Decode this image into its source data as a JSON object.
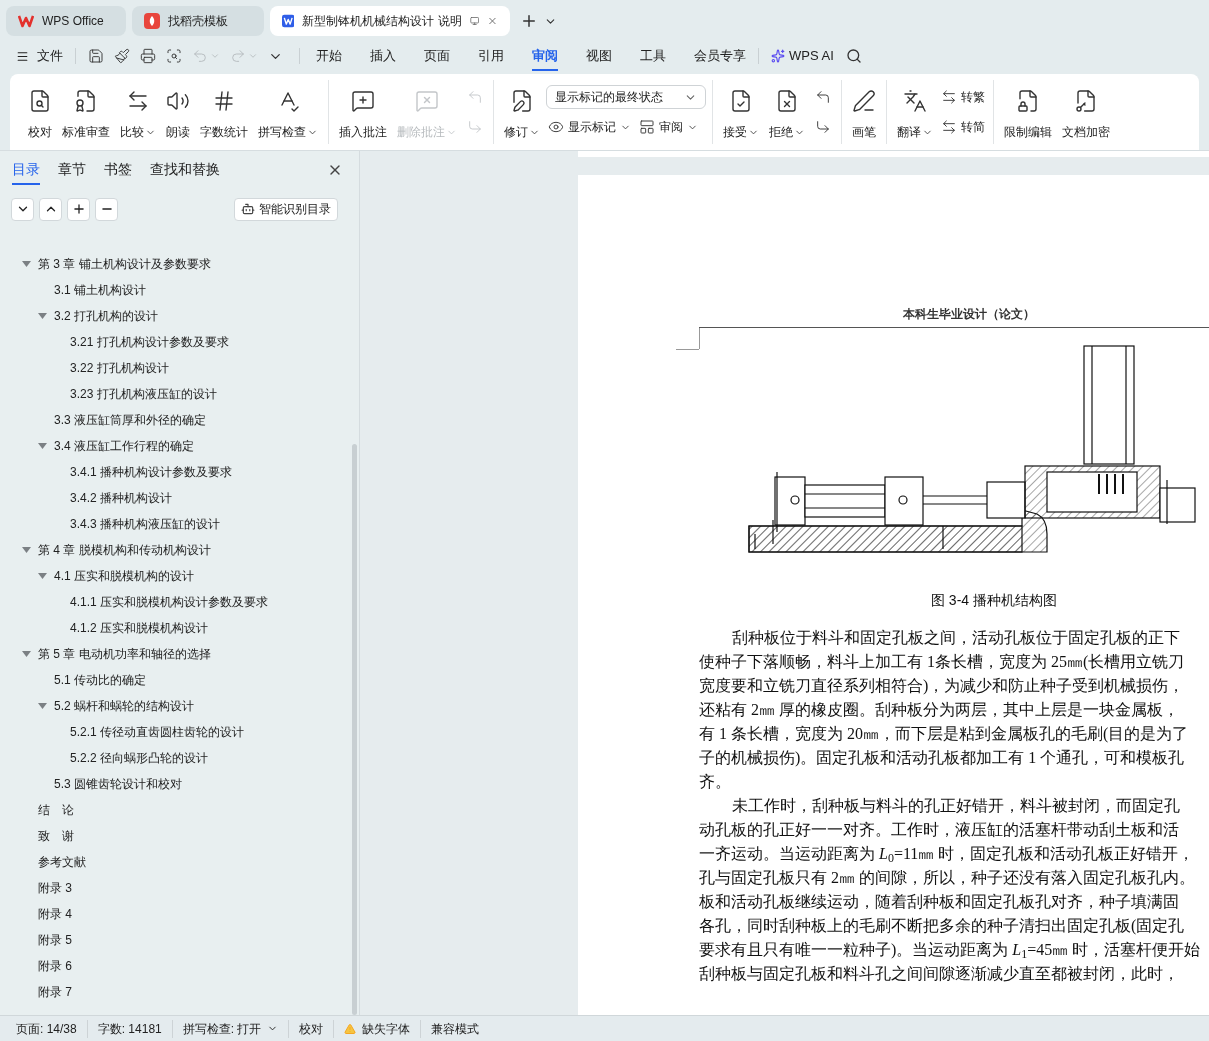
{
  "window_tabs": [
    {
      "kind": "wps",
      "title": "WPS Office",
      "selected": false
    },
    {
      "kind": "template",
      "title": "找稻壳模板",
      "selected": false
    },
    {
      "kind": "document",
      "title": "新型制钵机机械结构设计 说明",
      "selected": true
    }
  ],
  "menu": {
    "file": "文件",
    "tabs": [
      {
        "label": "开始",
        "selected": false
      },
      {
        "label": "插入",
        "selected": false
      },
      {
        "label": "页面",
        "selected": false
      },
      {
        "label": "引用",
        "selected": false
      },
      {
        "label": "审阅",
        "selected": true
      },
      {
        "label": "视图",
        "selected": false
      },
      {
        "label": "工具",
        "selected": false
      },
      {
        "label": "会员专享",
        "selected": false
      }
    ],
    "ai": "WPS AI"
  },
  "ribbon": [
    {
      "items": [
        {
          "kind": "large",
          "label": "校对"
        },
        {
          "kind": "large",
          "label": "标准审查"
        },
        {
          "kind": "large",
          "label": "比较",
          "caret": true
        },
        {
          "kind": "large",
          "label": "朗读"
        },
        {
          "kind": "large",
          "label": "字数统计"
        },
        {
          "kind": "large",
          "label": "拼写检查",
          "caret": true
        }
      ]
    },
    {
      "items": [
        {
          "kind": "large",
          "label": "插入批注",
          "disabled": false
        },
        {
          "kind": "large",
          "label": "删除批注",
          "caret": true,
          "disabled": true
        },
        {
          "kind": "stack",
          "disabled": true,
          "rows": [
            [
              {
                "kind": "icon"
              }
            ],
            [
              {
                "kind": "icon"
              }
            ]
          ]
        }
      ]
    },
    {
      "items": [
        {
          "kind": "large",
          "label": "修订",
          "caret": true
        },
        {
          "kind": "stack",
          "rows": [
            [
              {
                "kind": "select",
                "value": "显示标记的最终状态"
              }
            ],
            [
              {
                "kind": "small",
                "label": "显示标记",
                "caret": true
              },
              {
                "kind": "small",
                "label": "审阅",
                "caret": true
              }
            ]
          ]
        }
      ]
    },
    {
      "items": [
        {
          "kind": "large",
          "label": "接受",
          "caret": true
        },
        {
          "kind": "large",
          "label": "拒绝",
          "caret": true
        },
        {
          "kind": "stack",
          "rows": [
            [
              {
                "kind": "icon"
              }
            ],
            [
              {
                "kind": "icon"
              }
            ]
          ]
        }
      ]
    },
    {
      "items": [
        {
          "kind": "large",
          "label": "画笔"
        }
      ]
    },
    {
      "items": [
        {
          "kind": "large",
          "label": "翻译",
          "caret": true
        },
        {
          "kind": "stack",
          "rows": [
            [
              {
                "kind": "small",
                "label": "转繁"
              }
            ],
            [
              {
                "kind": "small",
                "label": "转简"
              }
            ]
          ]
        }
      ]
    },
    {
      "items": [
        {
          "kind": "large",
          "label": "限制编辑"
        },
        {
          "kind": "large",
          "label": "文档加密"
        }
      ]
    }
  ],
  "sidebar": {
    "tabs": [
      {
        "label": "目录",
        "selected": true
      },
      {
        "label": "章节",
        "selected": false
      },
      {
        "label": "书签",
        "selected": false
      },
      {
        "label": "查找和替换",
        "selected": false
      }
    ],
    "smart_button": "智能识别目录",
    "toc": [
      {
        "label": "第 3 章  铺土机构设计及参数要求",
        "expanded": true,
        "children": [
          {
            "label": "3.1  铺土机构设计"
          },
          {
            "label": "3.2  打孔机构的设计",
            "expanded": true,
            "children": [
              {
                "label": "3.21  打孔机构设计参数及要求"
              },
              {
                "label": "3.22  打孔机构设计"
              },
              {
                "label": "3.23  打孔机构液压缸的设计"
              }
            ]
          },
          {
            "label": "3.3  液压缸筒厚和外径的确定"
          },
          {
            "label": "3.4  液压缸工作行程的确定",
            "expanded": true,
            "children": [
              {
                "label": "3.4.1  播种机构设计参数及要求"
              },
              {
                "label": "3.4.2  播种机构设计"
              },
              {
                "label": "3.4.3  播种机构液压缸的设计"
              }
            ]
          }
        ]
      },
      {
        "label": "第 4 章  脱模机构和传动机构设计",
        "expanded": true,
        "children": [
          {
            "label": "4.1  压实和脱模机构的设计",
            "expanded": true,
            "children": [
              {
                "label": "4.1.1  压实和脱模机构设计参数及要求"
              },
              {
                "label": "4.1.2  压实和脱模机构设计"
              }
            ]
          }
        ]
      },
      {
        "label": "第 5 章  电动机功率和轴径的选择",
        "expanded": true,
        "children": [
          {
            "label": "5.1  传动比的确定"
          },
          {
            "label": "5.2  蜗杆和蜗轮的结构设计",
            "expanded": true,
            "children": [
              {
                "label": "5.2.1  传径动直齿圆柱齿轮的设计"
              },
              {
                "label": "5.2.2  径向蜗形凸轮的设计"
              }
            ]
          },
          {
            "label": "5.3 圆锥齿轮设计和校对"
          }
        ]
      },
      {
        "label": "结　论"
      },
      {
        "label": "致　谢"
      },
      {
        "label": "参考文献"
      },
      {
        "label": "附录 3"
      },
      {
        "label": "附录 4"
      },
      {
        "label": "附录 5"
      },
      {
        "label": "附录 6"
      },
      {
        "label": "附录 7"
      }
    ]
  },
  "document": {
    "header": "本科生毕业设计（论文）",
    "figure_caption": "图 3-4  播种机结构图",
    "lines": [
      {
        "text": "刮种板位于料斗和固定孔板之间，活动孔板位于固定孔板的正下",
        "indent": true
      },
      {
        "text": "使种子下落顺畅，料斗上加工有 1条长槽，宽度为 25㎜(长槽用立铣刀",
        "indent": false
      },
      {
        "text": "宽度要和立铣刀直径系列相符合)，为减少和防止种子受到机械损伤，",
        "indent": false
      },
      {
        "text": "还粘有 2㎜ 厚的橡皮圈。刮种板分为两层，其中上层是一块金属板，",
        "indent": false
      },
      {
        "text": "有 1 条长槽，宽度为 20㎜，而下层是粘到金属板孔的毛刷(目的是为了",
        "indent": false
      },
      {
        "text": "子的机械损伤)。固定孔板和活动孔板都加工有 1 个通孔，可和模板孔",
        "indent": false
      },
      {
        "text": "齐。",
        "indent": false
      },
      {
        "text": "未工作时，刮种板与料斗的孔正好错开，料斗被封闭，而固定孔",
        "indent": true
      },
      {
        "text": "动孔板的孔正好一一对齐。工作时，液压缸的活塞杆带动刮土板和活",
        "indent": false
      },
      {
        "text": "一齐运动。当运动距离为 *L*$_{0}$=11㎜ 时，固定孔板和活动孔板正好错开，",
        "indent": false
      },
      {
        "text": "孔与固定孔板只有 2㎜ 的间隙，所以，种子还没有落入固定孔板孔内。",
        "indent": false
      },
      {
        "text": "板和活动孔板继续运动，随着刮种板和固定孔板孔对齐，种子填满固",
        "indent": false
      },
      {
        "text": "各孔，同时刮种板上的毛刷不断把多余的种子清扫出固定孔板(固定孔",
        "indent": false
      },
      {
        "text": "要求有且只有唯一一粒种子)。当运动距离为 *L*$_{1}$=45㎜ 时，活塞杆便开始",
        "indent": false
      },
      {
        "text": "刮种板与固定孔板和料斗孔之间间隙逐渐减少直至都被封闭，此时，",
        "indent": false
      }
    ]
  },
  "status_bar": [
    {
      "kind": "text",
      "label": "页面: 14/38"
    },
    {
      "kind": "text",
      "label": "字数: 14181"
    },
    {
      "kind": "dropdown",
      "label": "拼写检查: 打开"
    },
    {
      "kind": "text",
      "label": "校对"
    },
    {
      "kind": "warning",
      "label": "缺失字体"
    },
    {
      "kind": "text",
      "label": "兼容模式"
    }
  ]
}
